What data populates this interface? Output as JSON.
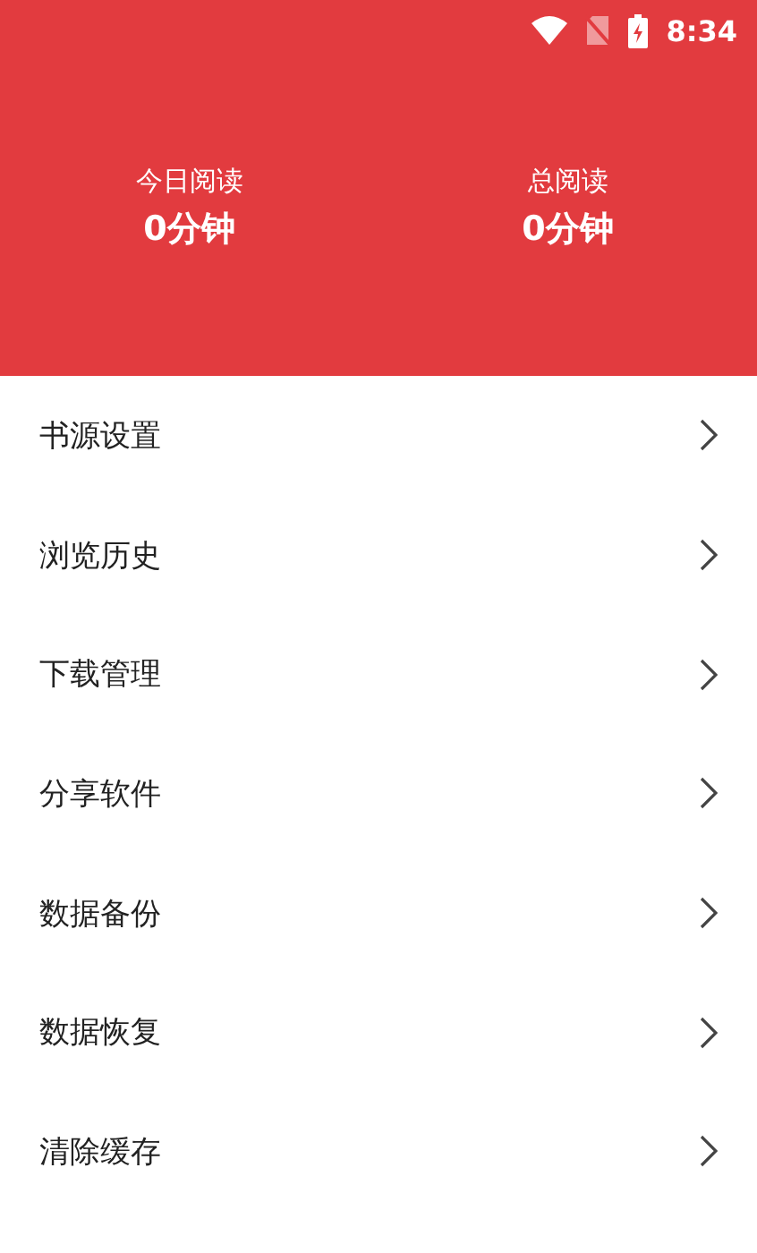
{
  "status_bar": {
    "time": "8:34"
  },
  "stats": [
    {
      "label": "今日阅读",
      "value": "0分钟"
    },
    {
      "label": "总阅读",
      "value": "0分钟"
    }
  ],
  "menu": [
    {
      "label": "书源设置"
    },
    {
      "label": "浏览历史"
    },
    {
      "label": "下载管理"
    },
    {
      "label": "分享软件"
    },
    {
      "label": "数据备份"
    },
    {
      "label": "数据恢复"
    },
    {
      "label": "清除缓存"
    }
  ]
}
